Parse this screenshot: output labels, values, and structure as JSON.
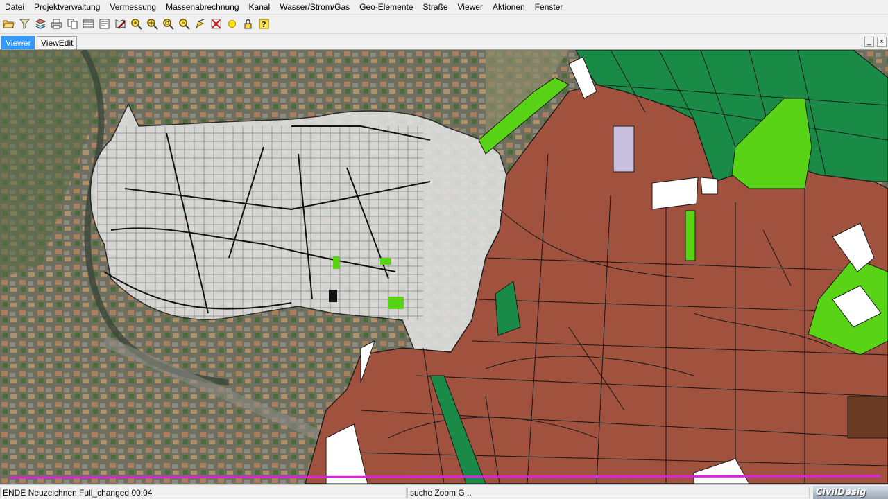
{
  "menu": {
    "items": [
      "Datei",
      "Projektverwaltung",
      "Vermessung",
      "Massenabrechnung",
      "Kanal",
      "Wasser/Strom/Gas",
      "Geo-Elemente",
      "Straße",
      "Viewer",
      "Aktionen",
      "Fenster"
    ]
  },
  "toolbar": {
    "buttons": [
      {
        "icon": "open-folder-icon"
      },
      {
        "icon": "filter-icon"
      },
      {
        "icon": "map-layers-icon"
      },
      {
        "icon": "print-icon"
      },
      {
        "icon": "copy-icon"
      },
      {
        "icon": "layer-list-icon"
      },
      {
        "icon": "plot-icon"
      },
      {
        "icon": "edit-map-icon"
      },
      {
        "icon": "zoom-in-icon"
      },
      {
        "icon": "zoom-full-icon"
      },
      {
        "icon": "zoom-window-icon"
      },
      {
        "icon": "zoom-out-icon"
      },
      {
        "icon": "pan-icon"
      },
      {
        "icon": "delete-icon"
      },
      {
        "icon": "point-icon"
      },
      {
        "icon": "lock-icon"
      },
      {
        "icon": "help-icon"
      }
    ]
  },
  "tabs": {
    "items": [
      "Viewer",
      "ViewEdit"
    ],
    "active": "Viewer"
  },
  "window_controls": {
    "minimize": "_",
    "close": "×"
  },
  "status": {
    "left": "ENDE Neuzeichnen Full_changed  00:04",
    "middle": "suche Zoom G ..",
    "logo": "CivilDesig"
  },
  "colors": {
    "tab_active": "#3399ff",
    "parcel_brown": "#a0523f",
    "parcel_green": "#1a8a47",
    "parcel_lightgreen": "#58d315",
    "town_overlay": "#e2e2e2",
    "magenta_line": "#e020e0"
  }
}
